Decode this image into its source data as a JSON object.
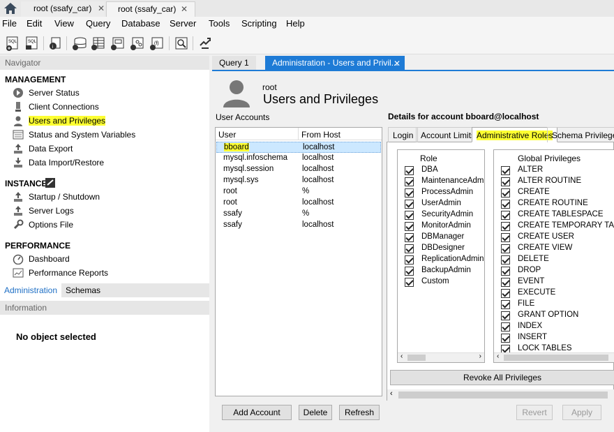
{
  "connection_tabs": [
    {
      "label": "root (ssafy_car)",
      "close": "✕"
    },
    {
      "label": "root (ssafy_car)",
      "close": "✕"
    }
  ],
  "menu": [
    "File",
    "Edit",
    "View",
    "Query",
    "Database",
    "Server",
    "Tools",
    "Scripting",
    "Help"
  ],
  "toolbar": {
    "icons": [
      "new-sql-tab-icon",
      "open-sql-script-icon",
      "inspector-icon",
      "create-schema-icon",
      "create-table-icon",
      "create-view-icon",
      "create-procedure-icon",
      "create-function-icon",
      "search-table-data-icon",
      "reconnect-icon"
    ],
    "icon_labels": [
      "SQL",
      "SQL"
    ]
  },
  "sidebar": {
    "navigator_label": "Navigator",
    "management_label": "MANAGEMENT",
    "management_items": [
      "Server Status",
      "Client Connections",
      "Users and Privileges",
      "Status and System Variables",
      "Data Export",
      "Data Import/Restore"
    ],
    "instance_label": "INSTANCE",
    "instance_items": [
      "Startup / Shutdown",
      "Server Logs",
      "Options File"
    ],
    "performance_label": "PERFORMANCE",
    "performance_items": [
      "Dashboard",
      "Performance Reports"
    ],
    "tabs": [
      "Administration",
      "Schemas"
    ],
    "information_label": "Information",
    "no_object": "No object selected"
  },
  "main": {
    "tabs": [
      {
        "label": "Query 1"
      },
      {
        "label": "Administration - Users and Privil...",
        "close": "✕"
      }
    ],
    "header_user": "root",
    "header_title": "Users and Privileges",
    "user_accounts_label": "User Accounts",
    "table_headers": [
      "User",
      "From Host"
    ],
    "accounts": [
      {
        "user": "bboard",
        "host": "localhost"
      },
      {
        "user": "mysql.infoschema",
        "host": "localhost"
      },
      {
        "user": "mysql.session",
        "host": "localhost"
      },
      {
        "user": "mysql.sys",
        "host": "localhost"
      },
      {
        "user": "root",
        "host": "%"
      },
      {
        "user": "root",
        "host": "localhost"
      },
      {
        "user": "ssafy",
        "host": "%"
      },
      {
        "user": "ssafy",
        "host": "localhost"
      }
    ],
    "buttons": {
      "add": "Add Account",
      "delete": "Delete",
      "refresh": "Refresh",
      "revert": "Revert",
      "apply": "Apply",
      "revoke": "Revoke All Privileges"
    },
    "details_title": "Details for account bboard@localhost",
    "detail_tabs": [
      "Login",
      "Account Limits",
      "Administrative Roles",
      "Schema Privileges"
    ],
    "role_header": "Role",
    "roles": [
      "DBA",
      "MaintenanceAdmi",
      "ProcessAdmin",
      "UserAdmin",
      "SecurityAdmin",
      "MonitorAdmin",
      "DBManager",
      "DBDesigner",
      "ReplicationAdmin",
      "BackupAdmin",
      "Custom"
    ],
    "global_header": "Global Privileges",
    "privileges": [
      "ALTER",
      "ALTER ROUTINE",
      "CREATE",
      "CREATE ROUTINE",
      "CREATE TABLESPACE",
      "CREATE TEMPORARY TABLE",
      "CREATE USER",
      "CREATE VIEW",
      "DELETE",
      "DROP",
      "EVENT",
      "EXECUTE",
      "FILE",
      "GRANT OPTION",
      "INDEX",
      "INSERT",
      "LOCK TABLES"
    ]
  },
  "colors": {
    "highlight": "#fdff32",
    "active_tab": "#1e7bd6",
    "selection": "#cce8ff"
  }
}
